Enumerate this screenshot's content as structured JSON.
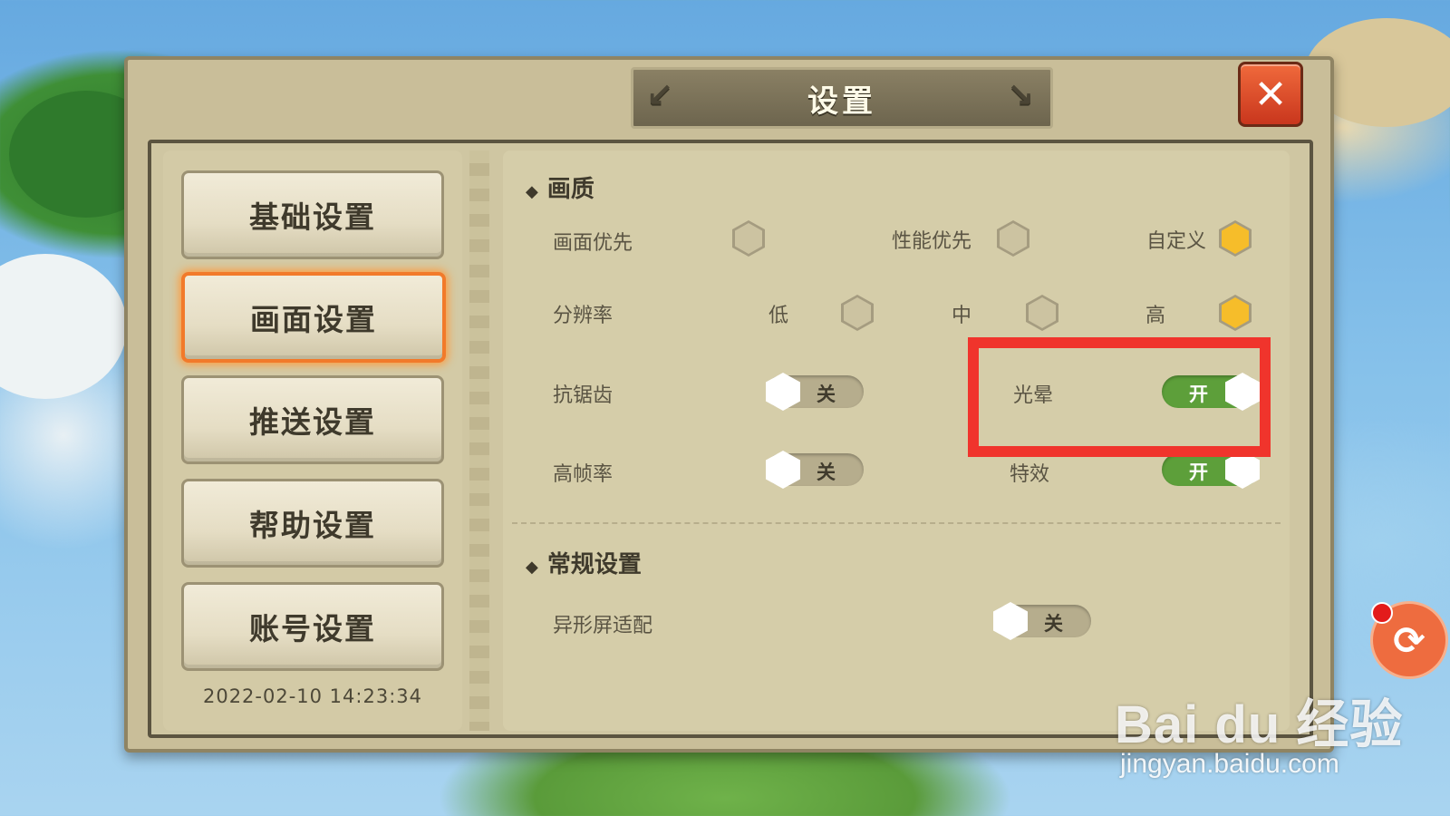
{
  "dialog": {
    "title": "设置",
    "close_icon": "close-icon"
  },
  "sidebar": {
    "items": [
      {
        "label": "基础设置",
        "active": false
      },
      {
        "label": "画面设置",
        "active": true
      },
      {
        "label": "推送设置",
        "active": false
      },
      {
        "label": "帮助设置",
        "active": false
      },
      {
        "label": "账号设置",
        "active": false
      }
    ],
    "timestamp": "2022-02-10 14:23:34"
  },
  "quality_section": {
    "heading": "画质",
    "preset": {
      "options": [
        {
          "label": "画面优先",
          "selected": false
        },
        {
          "label": "性能优先",
          "selected": false
        },
        {
          "label": "自定义",
          "selected": true
        }
      ]
    },
    "resolution": {
      "label": "分辨率",
      "options": [
        {
          "label": "低",
          "selected": false
        },
        {
          "label": "中",
          "selected": false
        },
        {
          "label": "高",
          "selected": true
        }
      ]
    },
    "antialias": {
      "label": "抗锯齿",
      "state": "关"
    },
    "bloom": {
      "label": "光晕",
      "state": "开"
    },
    "high_fps": {
      "label": "高帧率",
      "state": "关"
    },
    "effects": {
      "label": "特效",
      "state": "开"
    }
  },
  "general_section": {
    "heading": "常规设置",
    "notch_adapt": {
      "label": "异形屏适配",
      "state": "关"
    }
  },
  "overlay": {
    "watermark_main": "Bai du 经验",
    "watermark_url": "jingyan.baidu.com",
    "highlight_color": "#f0342c",
    "floating_button_icon": "refresh-icon"
  },
  "colors": {
    "toggle_on": "#5d9f3a",
    "hex_selected": "#f6bd2a",
    "active_border": "#f27a2a"
  }
}
